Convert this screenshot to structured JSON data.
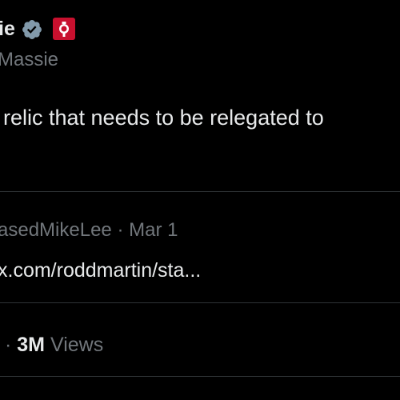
{
  "author": {
    "name_fragment": "ie",
    "handle_fragment": "Massie",
    "verified_icon": "verified-badge-icon",
    "flag_icon": "state-flag-icon"
  },
  "post": {
    "text_fragment": "relic that needs to be relegated to"
  },
  "quote": {
    "author_fragment": "asedMikeLee",
    "separator": "·",
    "date": "Mar 1",
    "link_fragment": "x.com/roddmartin/sta..."
  },
  "stats": {
    "separator": "·",
    "views_count": "3M",
    "views_label": "Views"
  },
  "colors": {
    "background": "#000000",
    "primary_text": "#e7e9ea",
    "secondary_text": "#71767b",
    "divider": "#2f3336",
    "verified": "#829aab",
    "flag": "#c8102e"
  }
}
